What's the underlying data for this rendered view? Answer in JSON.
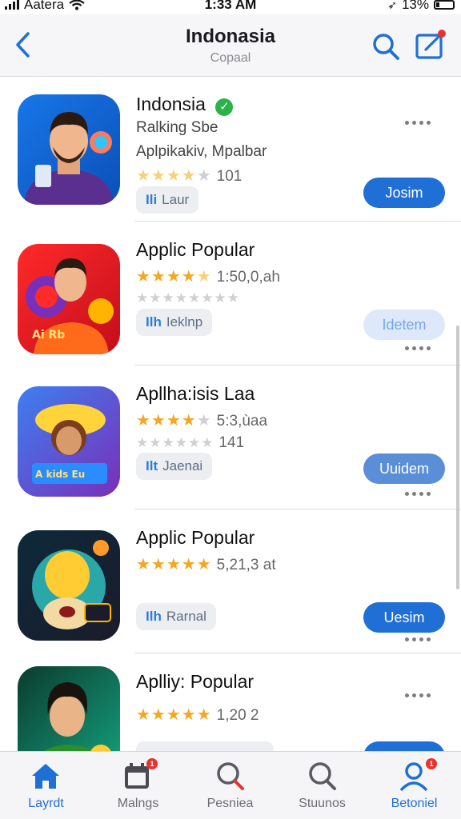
{
  "status_bar": {
    "carrier": "Aatera",
    "time": "1:33 AM",
    "battery": "13%"
  },
  "nav": {
    "title": "Indonasia",
    "subtitle": "Copaal"
  },
  "apps": [
    {
      "name": "Indonsia",
      "line1": "Ralking Sbe",
      "line2": "Aplpikakiv, Mpalbar",
      "rating_text": "101",
      "tag": "Laur",
      "action": "Josim"
    },
    {
      "name": "Applic Popular",
      "rating_text": "1:50,0,ah",
      "tag": "Ieklnp",
      "action": "Idetem"
    },
    {
      "name": "Apllha:isis Laa",
      "rating_text": "5:3,ùaa",
      "line2_rating": "141",
      "tag": "Jaenai",
      "action": "Uuidem"
    },
    {
      "name": "Applic Popular",
      "rating_text": "5,21,3 at",
      "tag": "Rarnal",
      "action": "Uesim"
    },
    {
      "name": "Aplliy: Popular",
      "rating_text": "1,20 2"
    }
  ],
  "tabs": [
    {
      "label": "Layrdt",
      "icon": "home-icon",
      "active": true
    },
    {
      "label": "Malngs",
      "icon": "calendar-icon",
      "badge": "1"
    },
    {
      "label": "Pesniea",
      "icon": "search-icon"
    },
    {
      "label": "Stuunos",
      "icon": "search-icon"
    },
    {
      "label": "Betoniel",
      "icon": "profile-icon",
      "badge": "1"
    }
  ],
  "colors": {
    "accent": "#1f6fd6",
    "star": "#f5a623",
    "badge": "#e8332c"
  }
}
